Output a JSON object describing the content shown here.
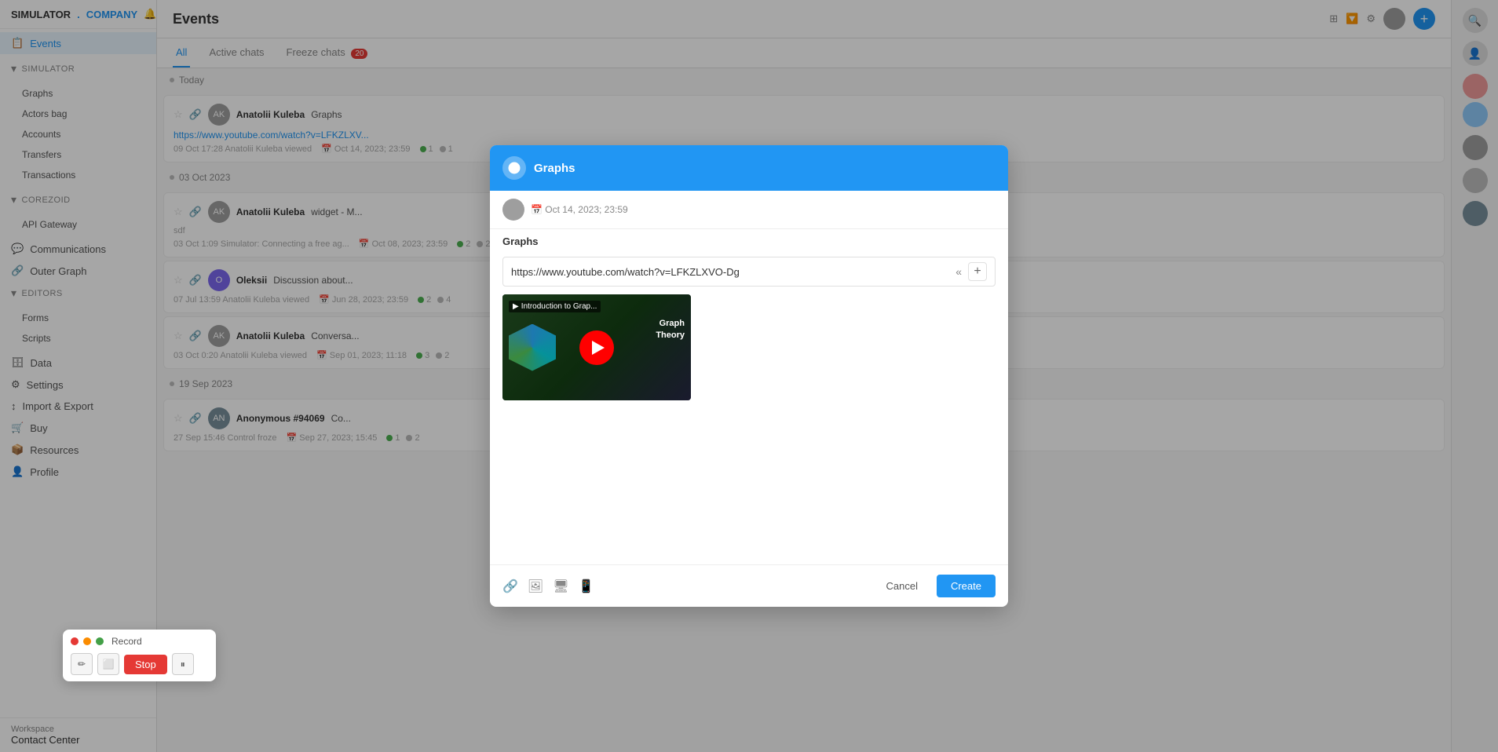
{
  "brand": {
    "simulator": "SIMULATOR",
    "dot": ".",
    "company": "COMPANY"
  },
  "sidebar": {
    "events_label": "Events",
    "simulator_label": "Simulator",
    "graphs_label": "Graphs",
    "actors_bag_label": "Actors bag",
    "accounts_label": "Accounts",
    "transfers_label": "Transfers",
    "transactions_label": "Transactions",
    "corezoid_label": "Corezoid",
    "api_gateway_label": "API Gateway",
    "communications_label": "Communications",
    "outer_graph_label": "Outer Graph",
    "editors_label": "Editors",
    "forms_label": "Forms",
    "scripts_label": "Scripts",
    "data_label": "Data",
    "settings_label": "Settings",
    "import_export_label": "Import & Export",
    "buy_label": "Buy",
    "resources_label": "Resources",
    "profile_label": "Profile",
    "workspace_label": "Workspace",
    "contact_center_label": "Contact Center"
  },
  "main": {
    "title": "Events",
    "tabs": [
      {
        "label": "All",
        "active": true
      },
      {
        "label": "Active chats",
        "active": false
      },
      {
        "label": "Freeze chats",
        "active": false,
        "badge": "20"
      }
    ],
    "events": [
      {
        "date_label": "Today",
        "user": "Anatolii Kuleba",
        "topic": "Graphs",
        "link": "https://www.youtube.com/watch?v=LFKZLXV...",
        "action": "09 Oct 17:28 Anatolii Kuleba viewed",
        "date2": "Oct 14, 2023; 23:59",
        "count1": "1",
        "count2": "1"
      },
      {
        "date_label": "03 Oct 2023",
        "user": "Anatolii Kuleba",
        "topic": "widget - M...",
        "content": "sdf",
        "action": "03 Oct 1:09 Simulator: Connecting a free ag...",
        "date2": "Oct 08, 2023; 23:59",
        "count1": "2",
        "count2": "2"
      },
      {
        "user": "Oleksii",
        "topic": "Discussion about...",
        "action": "07 Jul 13:59 Anatolii Kuleba viewed",
        "date2": "Jun 28, 2023; 23:59",
        "count1": "2",
        "count2": "4"
      },
      {
        "user": "Anatolii Kuleba",
        "topic": "Conversa...",
        "action": "03 Oct 0:20 Anatolii Kuleba viewed",
        "date2": "Sep 01, 2023; 11:18",
        "count1": "3",
        "count2": "2"
      },
      {
        "date_label": "19 Sep 2023",
        "user": "Anonymous #94069",
        "topic": "Co...",
        "action": "27 Sep 15:46 Control froze",
        "date2": "Sep 27, 2023; 15:45",
        "count1": "1",
        "count2": "2"
      }
    ]
  },
  "modal": {
    "title": "Graphs",
    "timestamp": "Oct 14, 2023; 23:59",
    "section_label": "Graphs",
    "url": "https://www.youtube.com/watch?v=LFKZLXVO-Dg",
    "video_title": "Introduction to Grap...",
    "video_subtitle": "Graph\nTheory",
    "cancel_label": "Cancel",
    "create_label": "Create"
  },
  "record_widget": {
    "title": "Record",
    "stop_label": "Stop"
  }
}
